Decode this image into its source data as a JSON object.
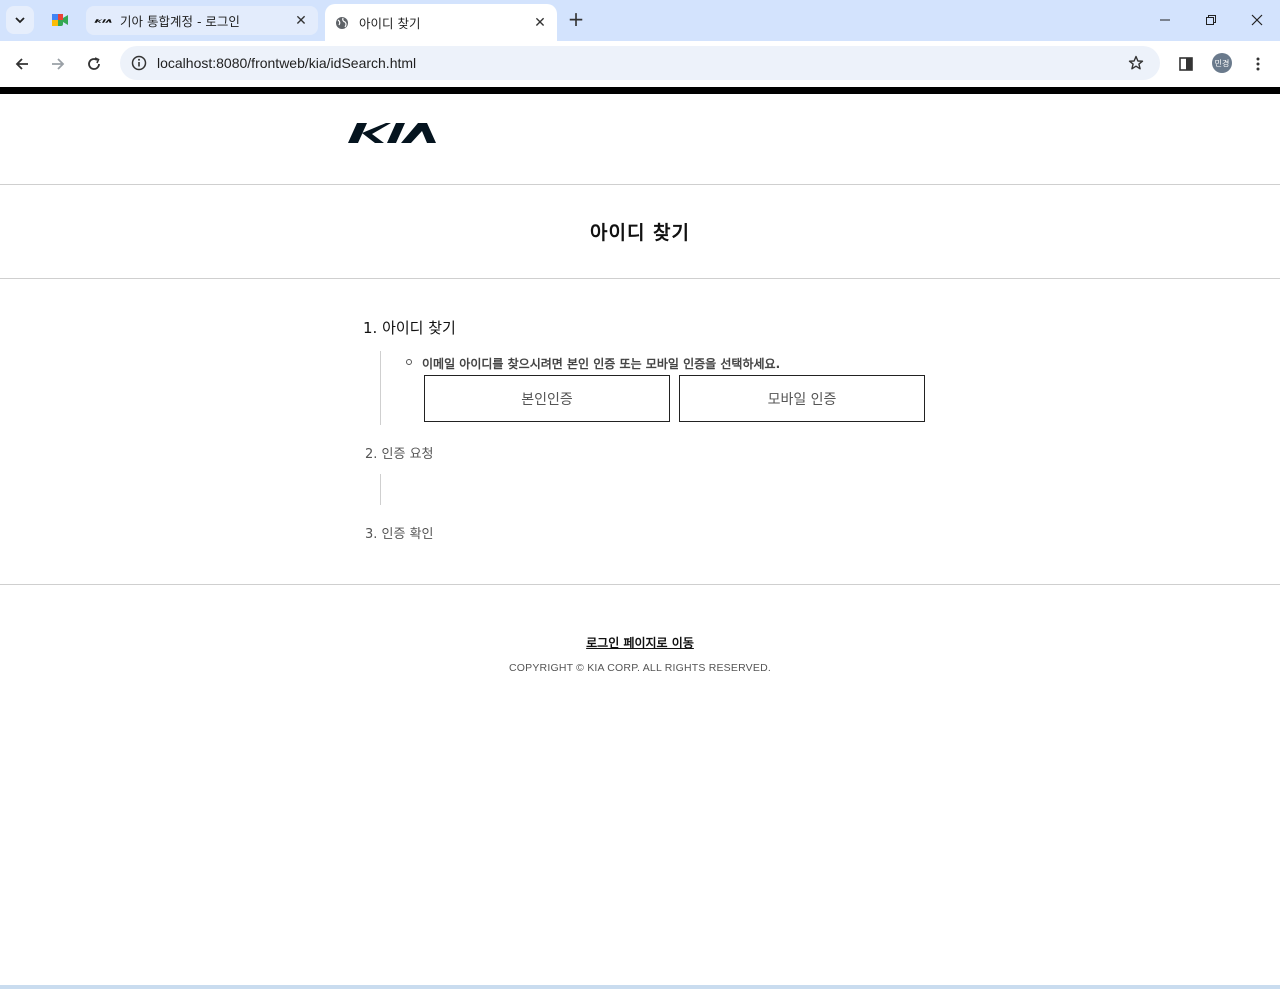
{
  "browser": {
    "tabs": [
      {
        "title": "기아 통합계정 - 로그인",
        "favicon": "kia-logo-icon",
        "active": false
      },
      {
        "title": "아이디 찾기",
        "favicon": "globe-icon",
        "active": true
      }
    ],
    "url": "localhost:8080/frontweb/kia/idSearch.html",
    "profile_initials": "민경"
  },
  "header": {
    "logo_text": "KIA"
  },
  "page": {
    "title": "아이디 찾기"
  },
  "steps": [
    {
      "label": "1. 아이디 찾기",
      "instruction": "이메일 아이디를 찾으시려면 본인 인증 또는 모바일 인증을 선택하세요.",
      "buttons": [
        "본인인증",
        "모바일 인증"
      ]
    },
    {
      "label": "2. 인증 요청"
    },
    {
      "label": "3. 인증 확인"
    }
  ],
  "footer": {
    "login_link": "로그인 페이지로 이동",
    "copyright": "COPYRIGHT © KIA CORP. ALL RIGHTS RESERVED."
  }
}
